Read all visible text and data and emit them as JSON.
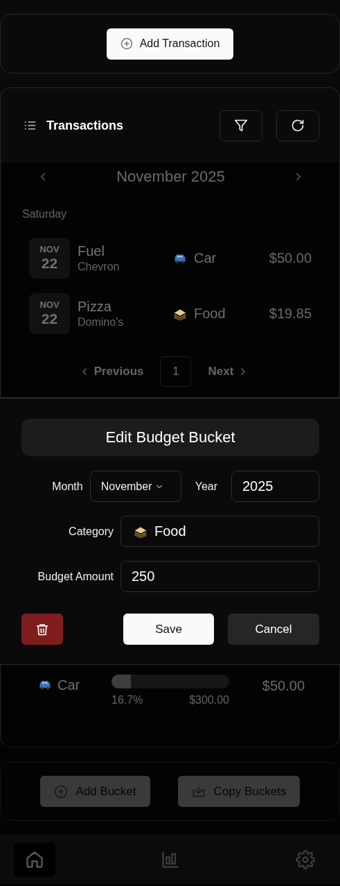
{
  "add_transaction_button": {
    "label": "Add Transaction"
  },
  "transactions": {
    "title": "Transactions",
    "month_nav": {
      "label": "November 2025"
    },
    "groups": [
      {
        "day": "Saturday",
        "items": [
          {
            "month": "NOV",
            "day": "22",
            "title": "Fuel",
            "merchant": "Chevron",
            "category": {
              "kind": "car",
              "name": "Car"
            },
            "amount": "$50.00"
          },
          {
            "month": "NOV",
            "day": "22",
            "title": "Pizza",
            "merchant": "Domino's",
            "category": {
              "kind": "food",
              "name": "Food"
            },
            "amount": "$19.85"
          }
        ]
      }
    ],
    "pagination": {
      "previous": "Previous",
      "next": "Next",
      "pages": [
        {
          "label": "1",
          "selected": true
        }
      ]
    }
  },
  "buckets": [
    {
      "kind": "car",
      "name": "Car",
      "level": 0.167,
      "percent": "16.7%",
      "budget": "$300.00",
      "spent": "$50.00"
    }
  ],
  "bucket_actions": [
    {
      "kind": "add",
      "label": "Add Bucket"
    },
    {
      "kind": "copy",
      "label": "Copy Buckets"
    }
  ],
  "edit_sheet": {
    "title": "Edit Budget Bucket",
    "month": {
      "label": "Month",
      "value": "November"
    },
    "year": {
      "label": "Year",
      "value": "2025"
    },
    "category": {
      "label": "Category",
      "kind": "food",
      "value": "Food"
    },
    "amount": {
      "label": "Budget Amount",
      "value": "250"
    },
    "save": "Save",
    "cancel": "Cancel"
  },
  "bottom_nav": [
    {
      "kind": "home",
      "selected": true
    },
    {
      "kind": "chart",
      "selected": false
    },
    {
      "kind": "settings",
      "selected": false
    }
  ]
}
